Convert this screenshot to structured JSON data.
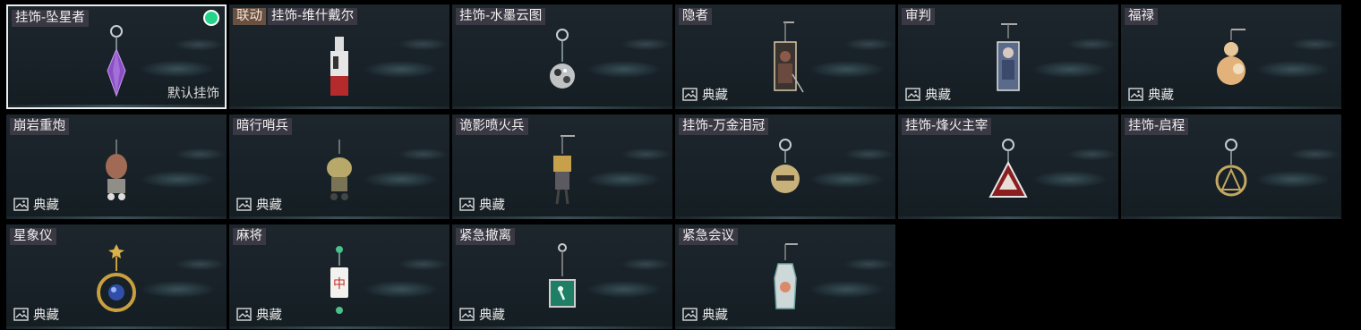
{
  "cards": [
    {
      "name": "挂饰-坠星者",
      "selected": true,
      "corner_label": "默认挂饰"
    },
    {
      "collab_tag": "联动",
      "name": "挂饰-维什戴尔"
    },
    {
      "name": "挂饰-水墨云图"
    },
    {
      "name": "隐者",
      "badge": "典藏"
    },
    {
      "name": "审判",
      "badge": "典藏"
    },
    {
      "name": "福禄",
      "badge": "典藏"
    },
    {
      "name": "崩岩重炮",
      "badge": "典藏"
    },
    {
      "name": "暗行哨兵",
      "badge": "典藏"
    },
    {
      "name": "诡影喷火兵",
      "badge": "典藏"
    },
    {
      "name": "挂饰-万金泪冠"
    },
    {
      "name": "挂饰-烽火主宰"
    },
    {
      "name": "挂饰-启程"
    },
    {
      "name": "星象仪",
      "badge": "典藏"
    },
    {
      "name": "麻将",
      "badge": "典藏"
    },
    {
      "name": "紧急撤离",
      "badge": "典藏"
    },
    {
      "name": "紧急会议",
      "badge": "典藏"
    }
  ],
  "icons": {
    "badge": "image-icon",
    "selected": "green-dot-icon"
  },
  "colors": {
    "selected_dot": "#25d38a",
    "selected_border": "#e9eef0",
    "collab_tag": "#6a5040"
  }
}
